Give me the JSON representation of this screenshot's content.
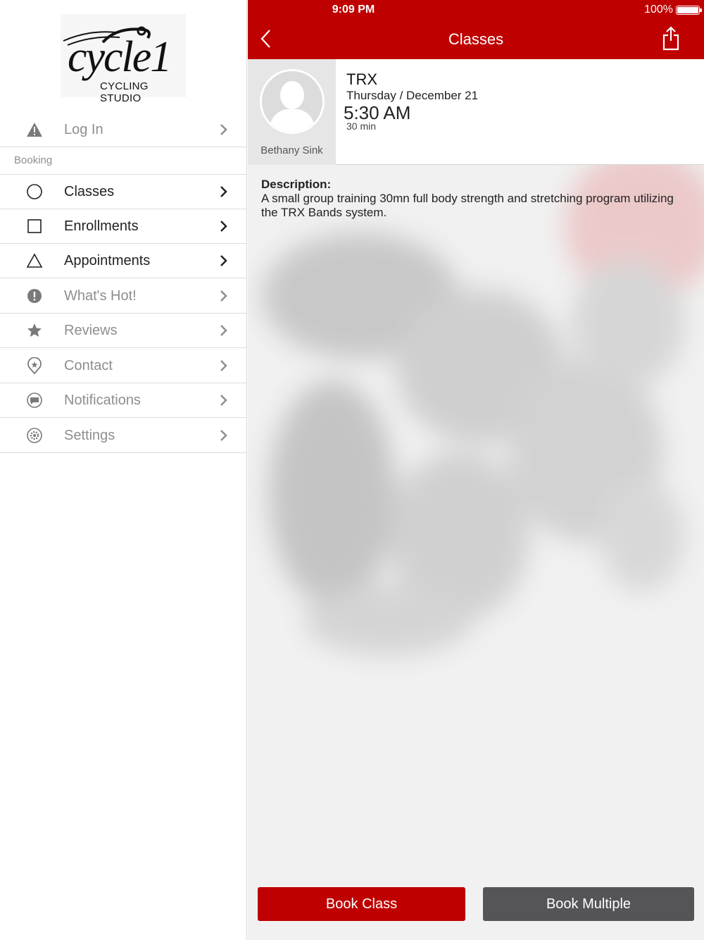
{
  "status_bar": {
    "time": "9:09 PM",
    "battery": "100%"
  },
  "logo": {
    "word": "cycle1",
    "subtitle": "CYCLING STUDIO"
  },
  "sidebar": {
    "login": {
      "label": "Log In",
      "icon": "warning-icon"
    },
    "section": "Booking",
    "items": [
      {
        "label": "Classes",
        "icon": "circle-icon"
      },
      {
        "label": "Enrollments",
        "icon": "square-icon"
      },
      {
        "label": "Appointments",
        "icon": "triangle-icon"
      },
      {
        "label": "What's Hot!",
        "icon": "exclamation-icon"
      },
      {
        "label": "Reviews",
        "icon": "star-icon"
      },
      {
        "label": "Contact",
        "icon": "location-pin-icon"
      },
      {
        "label": "Notifications",
        "icon": "chat-bubble-icon"
      },
      {
        "label": "Settings",
        "icon": "gear-icon"
      }
    ]
  },
  "header": {
    "title": "Classes"
  },
  "class_info": {
    "instructor": "Bethany Sink",
    "name": "TRX",
    "date": "Thursday / December 21",
    "time": "5:30 AM",
    "duration": "30 min"
  },
  "description": {
    "title": "Description:",
    "text": "A small group training 30mn full body strength and stretching program utilizing the TRX Bands system."
  },
  "buttons": {
    "book": "Book Class",
    "book_multiple": "Book Multiple"
  },
  "colors": {
    "brand_red": "#bf0000",
    "secondary_button": "#555558"
  }
}
